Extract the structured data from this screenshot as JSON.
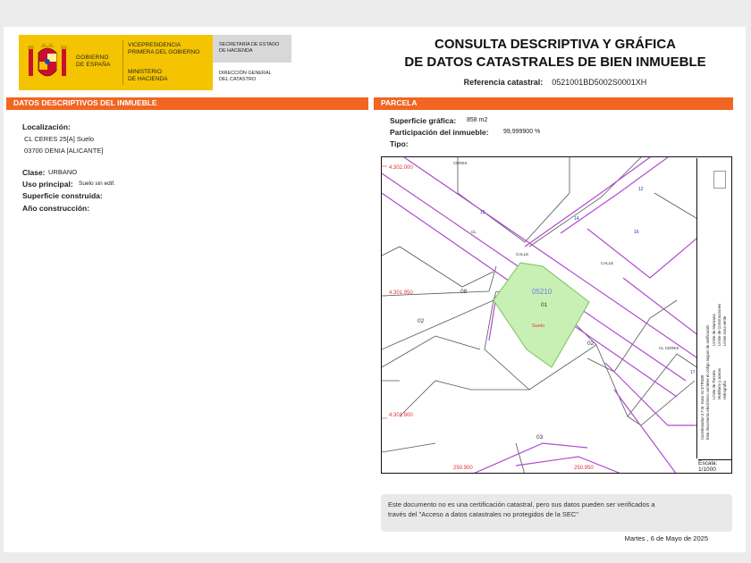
{
  "header": {
    "gobierno": [
      "GOBIERNO",
      "DE ESPAÑA"
    ],
    "vicepresidencia": [
      "VICEPRESIDENCIA",
      "PRIMERA DEL GOBIERNO"
    ],
    "ministerio": [
      "MINISTERIO",
      "DE HACIENDA"
    ],
    "secretaria": [
      "SECRETARÍA DE ESTADO",
      "DE HACIENDA"
    ],
    "direccion": [
      "DIRECCIÓN GENERAL",
      "DEL CATASTRO"
    ],
    "title_line1": "CONSULTA DESCRIPTIVA Y GRÁFICA",
    "title_line2": "DE DATOS CATASTRALES DE BIEN INMUEBLE",
    "ref_label": "Referencia catastral:",
    "ref_value": "0521001BD5002S0001XH"
  },
  "left": {
    "band_title": "DATOS DESCRIPTIVOS DEL INMUEBLE",
    "localizacion_label": "Localización:",
    "localizacion_line1": "CL CERES 25[A] Suelo",
    "localizacion_line2": "03700 DENIA [ALICANTE]",
    "clase_label": "Clase:",
    "clase_value": "URBANO",
    "uso_label": "Uso principal:",
    "uso_value": "Suelo sin edif.",
    "superficie_label": "Superficie construida:",
    "anio_label": "Año construcción:"
  },
  "right": {
    "band_title": "PARCELA",
    "sup_label": "Superficie gráfica:",
    "sup_value": "858 m2",
    "part_label": "Participación del inmueble:",
    "part_value": "99,999900 %",
    "tipo_label": "Tipo:"
  },
  "map": {
    "coords": {
      "top_left": "4.302.000",
      "mid_left": "4.301.950",
      "low_left": "4.301.900",
      "bottom_mid": "250.900",
      "bottom_right": "250.950"
    },
    "parcel_id": "05210",
    "parcel_no": "01",
    "parcel_use": "Suelo",
    "labels": [
      "08",
      "02",
      "02",
      "03",
      "14",
      "12",
      "15",
      "16",
      "17"
    ],
    "streets": [
      "CERES",
      "CL CERES",
      "CALLE",
      "CL",
      "CALLE"
    ],
    "legend": [
      "Límite de Manzana",
      "Límite de Parcela",
      "Límite de Construcciones",
      "Mobiliario y aceras",
      "Límite zona verde",
      "Hidrografía",
      "Este documento electrónico contiene el código seguro de verificación",
      "Coordenadas U.T.M. Huso 31 ETRS89"
    ],
    "escala_label": "Escala:",
    "escala_value": "1/1000",
    "colors": {
      "parcel_fill": "#c8f0b4",
      "street_line": "#b14bd1",
      "coord_text": "#e0303a"
    }
  },
  "note": {
    "text_line1": "Este documento no es una certificación catastral, pero sus datos pueden ser verificados a",
    "text_line2": "través del \"Acceso a datos catastrales no protegidos de la SEC\""
  },
  "date": "Martes , 6 de Mayo de 2025"
}
